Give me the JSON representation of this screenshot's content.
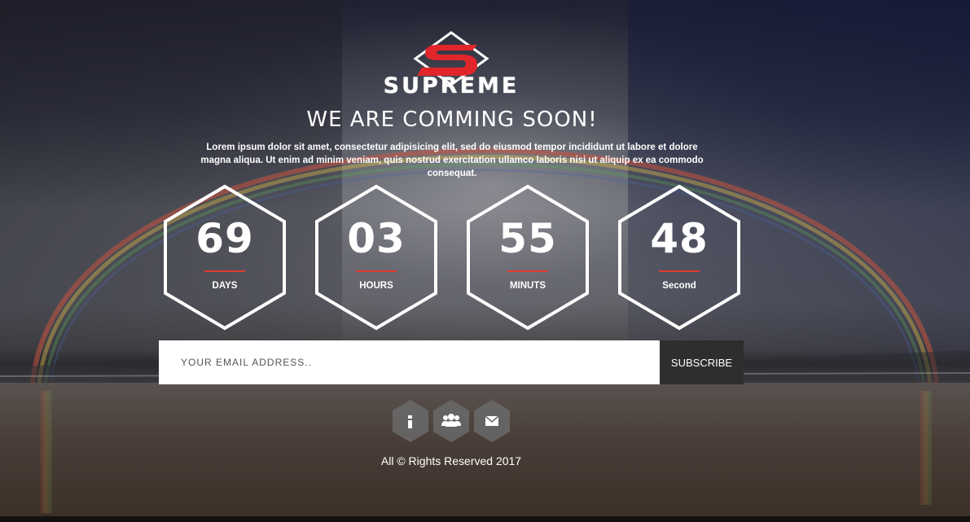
{
  "brand": {
    "name": "SUPREME",
    "mark_letter": "S",
    "mark_color": "#e0262b"
  },
  "headline": "WE ARE COMMING SOON!",
  "intro": "Lorem ipsum dolor sit amet, consectetur adipisicing elit, sed do eiusmod tempor incididunt ut labore et dolore magna aliqua. Ut enim ad minim veniam, quis nostrud exercitation ullamco laboris nisi ut aliquip ex ea commodo consequat.",
  "countdown": [
    {
      "value": "69",
      "label": "DAYS"
    },
    {
      "value": "03",
      "label": "HOURS"
    },
    {
      "value": "55",
      "label": "MINUTS"
    },
    {
      "value": "48",
      "label": "Second"
    }
  ],
  "subscribe": {
    "placeholder": "YOUR EMAIL ADDRESS..",
    "value": "",
    "button_label": "SUBSCRIBE"
  },
  "social": [
    {
      "icon": "info-icon"
    },
    {
      "icon": "users-icon"
    },
    {
      "icon": "envelope-icon"
    }
  ],
  "footer": "All © Rights Reserved 2017",
  "colors": {
    "accent": "#e03a2f",
    "button_bg": "#2e2e2e",
    "hex_fill": "#6a6a6a"
  }
}
